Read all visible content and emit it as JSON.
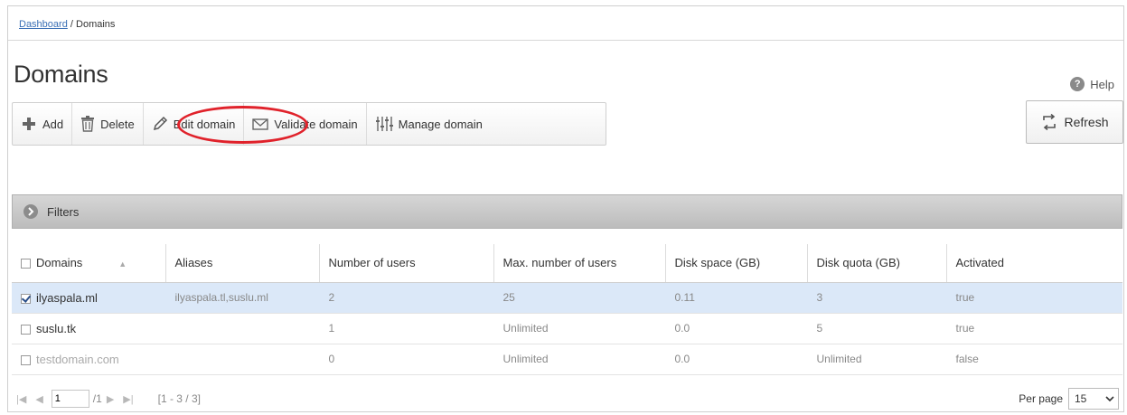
{
  "breadcrumb": {
    "root_link": "Dashboard",
    "separator": "/",
    "current": "Domains"
  },
  "page": {
    "title": "Domains",
    "help_label": "Help"
  },
  "toolbar": {
    "add": "Add",
    "delete": "Delete",
    "edit": "Edit domain",
    "validate": "Validate domain",
    "manage": "Manage domain",
    "refresh": "Refresh"
  },
  "filters": {
    "label": "Filters"
  },
  "table": {
    "columns": [
      "Domains",
      "Aliases",
      "Number of users",
      "Max. number of users",
      "Disk space (GB)",
      "Disk quota (GB)",
      "Activated"
    ],
    "rows": [
      {
        "domain": "ilyaspala.ml",
        "aliases": "ilyaspala.tl,suslu.ml",
        "users": "2",
        "max_users": "25",
        "disk_space": "0.11",
        "disk_quota": "3",
        "activated": "true"
      },
      {
        "domain": "suslu.tk",
        "aliases": "",
        "users": "1",
        "max_users": "Unlimited",
        "disk_space": "0.0",
        "disk_quota": "5",
        "activated": "true"
      },
      {
        "domain": "testdomain.com",
        "aliases": "",
        "users": "0",
        "max_users": "Unlimited",
        "disk_space": "0.0",
        "disk_quota": "Unlimited",
        "activated": "false"
      }
    ]
  },
  "pager": {
    "page": "1",
    "total_pages": "/1",
    "range": "[1 - 3 / 3]",
    "per_page_label": "Per page",
    "per_page_value": "15"
  },
  "colors": {
    "highlight": "#e0222b",
    "selected_row": "#dbe8f8",
    "link": "#3a6fb5"
  }
}
